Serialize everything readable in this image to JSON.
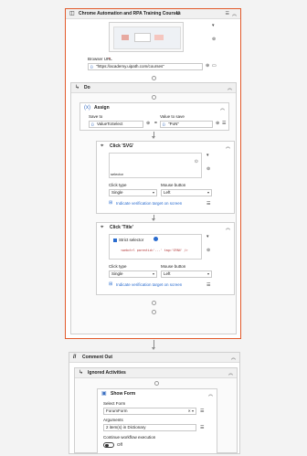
{
  "use_browser": {
    "title": "Chrome Automation and RPA Training Courses",
    "title_badge": "U",
    "url_label": "Browser URL",
    "url_value": "\"https://academy.uipath.com/courses\""
  },
  "do_block": {
    "title": "Do"
  },
  "assign": {
    "title": "Assign",
    "save_to_label": "Save to",
    "save_to_value": "ValueToSelect",
    "value_label": "Value to save",
    "value_value": "\"PoN\""
  },
  "click_svg": {
    "title": "Click 'SVG'",
    "preview_text": "selector",
    "click_type_label": "Click type",
    "click_type_value": "Single",
    "mouse_button_label": "Mouse button",
    "mouse_button_value": "Left",
    "verify_link": "Indicate verification target on screen"
  },
  "click_title": {
    "title": "Click 'Title'",
    "strict_selector": "Strict selector",
    "selector_code": "<webctrl parentid='...' tag='SPAN' />",
    "click_type_label": "Click type",
    "click_type_value": "Single",
    "mouse_button_label": "Mouse button",
    "mouse_button_value": "Left",
    "verify_link": "Indicate verification target on screen"
  },
  "comment_out": {
    "title": "Comment Out"
  },
  "ignored": {
    "title": "Ignored Activities"
  },
  "show_form": {
    "title": "Show Form",
    "select_form_label": "Select Form",
    "select_form_value": "ForumForm",
    "arguments_label": "Arguments",
    "arguments_value": "2 item(s) in Dictionary",
    "continue_label": "Continue workflow execution",
    "toggle_label": "Off"
  },
  "colors": {
    "selected_border": "#e25a2b",
    "link": "#2a6ccf"
  }
}
